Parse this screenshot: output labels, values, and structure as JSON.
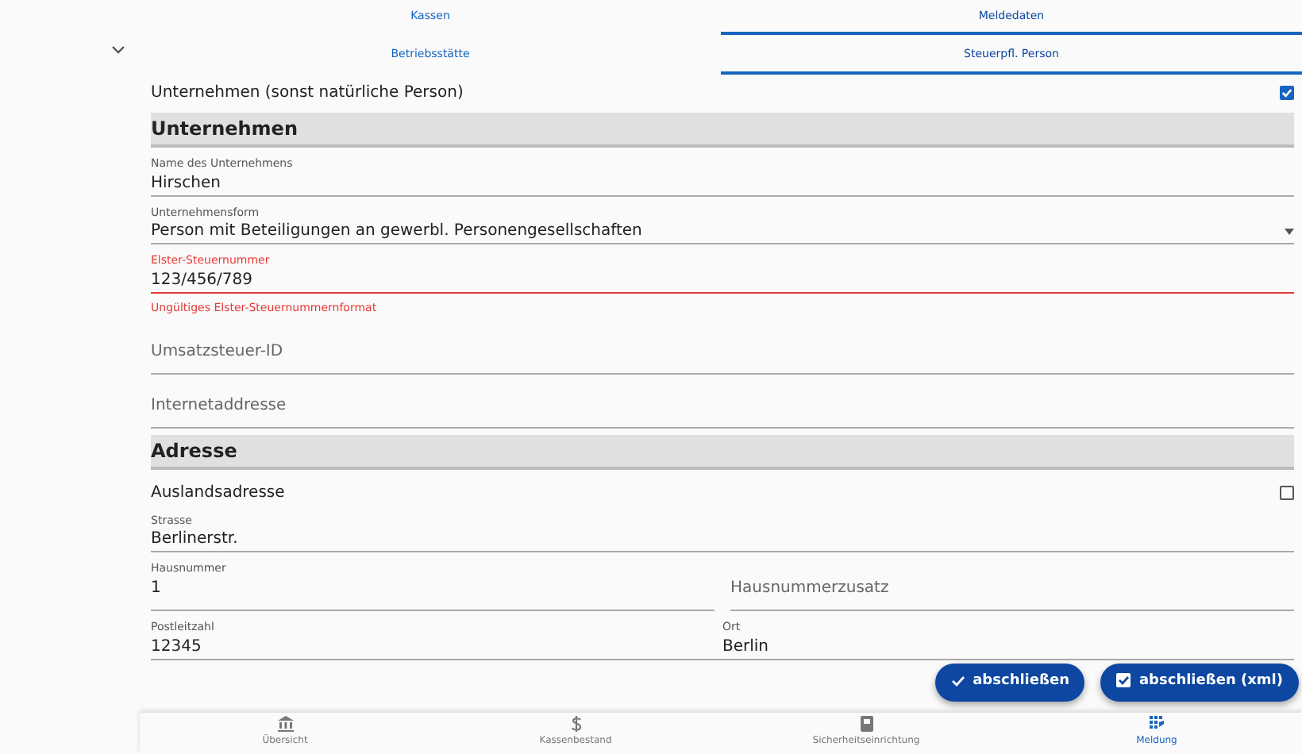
{
  "top_tabs": [
    {
      "label": "Kassen",
      "selected": false
    },
    {
      "label": "Meldedaten",
      "selected": true
    }
  ],
  "sub_tabs": [
    {
      "label": "Betriebsstätte",
      "selected": false
    },
    {
      "label": "Steuerpfl. Person",
      "selected": true
    }
  ],
  "form": [
    {
      "kind": "checkbox",
      "label": "Unternehmen (sonst natürliche Person)",
      "checked": true
    },
    {
      "kind": "section",
      "label": "Unternehmen"
    },
    {
      "kind": "text",
      "label": "Name des Unternehmens",
      "value": "Hirschen"
    },
    {
      "kind": "select",
      "label": "Unternehmensform",
      "value": "Person mit Beteiligungen an gewerbl. Personengesellschaften"
    },
    {
      "kind": "text",
      "label": "Elster-Steuernummer",
      "value": "123/456/789",
      "error": "Ungültiges Elster-Steuernummernformat"
    },
    {
      "kind": "text",
      "placeholder": "Umsatzsteuer-ID"
    },
    {
      "kind": "text",
      "placeholder": "Internetaddresse"
    },
    {
      "kind": "section",
      "label": "Adresse"
    },
    {
      "kind": "checkbox",
      "label": "Auslandsadresse",
      "checked": false
    },
    {
      "kind": "text",
      "label": "Strasse",
      "value": "Berlinerstr."
    },
    {
      "kind": "row",
      "fields": [
        {
          "label": "Hausnummer",
          "value": "1"
        },
        {
          "placeholder": "Hausnummerzusatz"
        }
      ]
    },
    {
      "kind": "row",
      "fields": [
        {
          "label": "Postleitzahl",
          "value": "12345"
        },
        {
          "label": "Ort",
          "value": "Berlin"
        }
      ]
    }
  ],
  "actions": [
    {
      "kind": "check",
      "label": "abschließen"
    },
    {
      "kind": "checkbox",
      "label": "abschließen (xml)"
    }
  ],
  "bottom_nav": [
    {
      "kind": "bank",
      "label": "Übersicht",
      "selected": false
    },
    {
      "kind": "dollar",
      "label": "Kassenbestand",
      "selected": false
    },
    {
      "kind": "safe",
      "label": "Sicherheitseinrichtung",
      "selected": false
    },
    {
      "kind": "grid",
      "label": "Meldung",
      "selected": true
    }
  ]
}
